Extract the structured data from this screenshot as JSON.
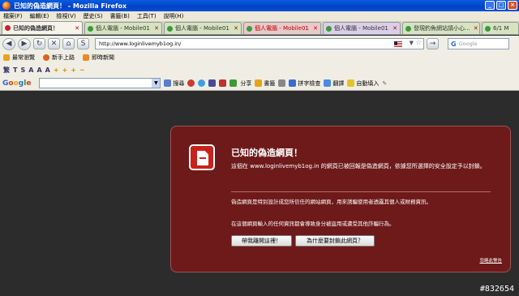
{
  "window": {
    "title": "已知的偽造網頁！ - Mozilla Firefox",
    "minimize": "_",
    "maximize": "□",
    "close": "×"
  },
  "menu": [
    "檔案(F)",
    "編輯(E)",
    "檢視(V)",
    "歷史(S)",
    "書籤(B)",
    "工具(T)",
    "說明(H)"
  ],
  "tabs": [
    {
      "label": "已知的偽造網頁！",
      "active": true,
      "color": "#d02020"
    },
    {
      "label": "個人電腦 - Mobile01",
      "active": false,
      "color": "#3a9a3a"
    },
    {
      "label": "個人電腦 - Mobile01",
      "active": false,
      "color": "#3a9a3a"
    },
    {
      "label": "個人電腦 - Mobile01",
      "active": false,
      "color": "#3a9a3a"
    },
    {
      "label": "個人電腦 - Mobile01",
      "active": false,
      "color": "#3a9a3a"
    },
    {
      "label": "發現釣魚網站請小心...",
      "active": false,
      "color": "#3a9a3a"
    },
    {
      "label": "6/1 M",
      "active": false,
      "color": "#3a9a3a"
    }
  ],
  "nav": {
    "url": "http://www.loginlivemyb1og.in/",
    "search_placeholder": "Google",
    "search_logo": "G"
  },
  "bookmarks": [
    "最常瀏覽",
    "新手上路",
    "即時新聞"
  ],
  "format_bar": [
    "繁",
    "T",
    "S",
    "A",
    "A",
    "A",
    "+",
    "+",
    "+",
    "~"
  ],
  "google_toolbar": {
    "logo": "Google",
    "items": [
      "搜尋",
      "分享",
      "書籤",
      "拼字檢查",
      "翻譯",
      "自動填入"
    ]
  },
  "warning": {
    "title": "已知的偽造網頁！",
    "message1": "這個在 www.loginlivemyb1og.in 的網頁已被回報是偽造網頁，依據您所選擇的安全設定予以封鎖。",
    "message2": "偽造網頁是特別設計成您所信任的網站網頁，用來誘騙使用者透露其個人或財務資訊。",
    "message3": "在這個網頁輸入的任何資訊都會導致身分被盜用或遭受其他詐騙行為。",
    "button_home": "帶我離開這裡！",
    "button_why": "為什麼要封鎖此網頁？",
    "ignore_link": "忽略此警告"
  },
  "watermark": "#832654"
}
